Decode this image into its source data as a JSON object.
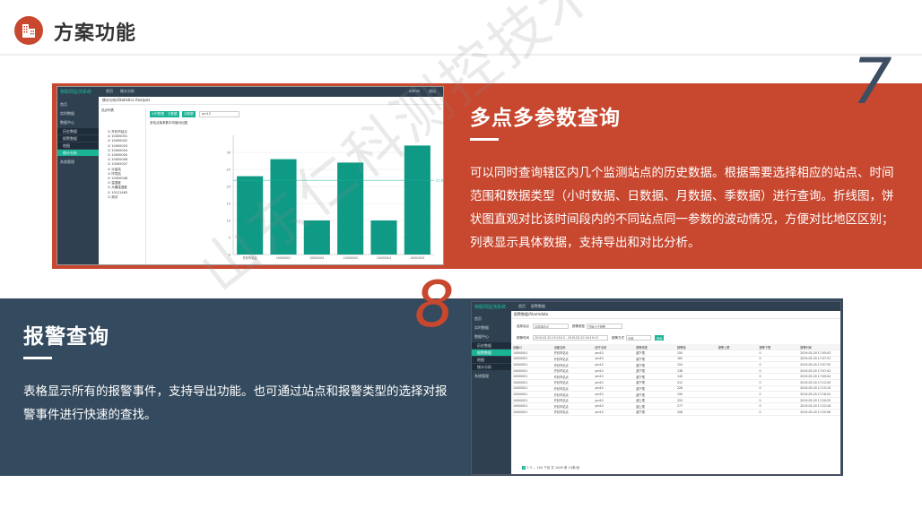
{
  "header": {
    "title": "方案功能"
  },
  "section7": {
    "number": "7",
    "title": "多点多参数查询",
    "description": "可以同时查询辖区内几个监测站点的历史数据。根据需要选择相应的站点、时间范围和数据类型（小时数据、日数据、月数据、季数据）进行查询。折线图，饼状图直观对比该时间段内的不同站点同一参数的波动情况，方便对比地区区别；列表显示具体数据，支持导出和对比分析。"
  },
  "section8": {
    "number": "8",
    "title": "报警查询",
    "description": "表格显示所有的报警事件，支持导出功能。也可通过站点和报警类型的选择对报警事件进行快速的查找。"
  },
  "watermark": "山东仁科测控技术有限公司",
  "screenshot1": {
    "brand": "物联网监测系统",
    "nav": [
      "首页",
      "统计分析"
    ],
    "user": [
      "admin",
      "退出"
    ],
    "sidebar": [
      "首页",
      "实时数据",
      "数据中心",
      "历史数据",
      "报警数据",
      "地图",
      "统计分析",
      "系统管理"
    ],
    "breadcrumb": "统计分析/Statistics Analysis",
    "tree_title": "站点列表",
    "tree_items": [
      "站点列表",
      "开封市站点",
      "10000001",
      "10000002",
      "10000003",
      "10000004",
      "10000005",
      "10000006",
      "10000007",
      "计量站",
      "环境站",
      "10000008",
      "温湿度",
      "大棚温湿度",
      "10121465",
      "测试"
    ],
    "tabs": [
      "小时数据",
      "日数据",
      "月数据"
    ],
    "select": "pm10",
    "chart_title": "多站点各参数平均值对比图",
    "colors": {
      "accent": "#1ab394",
      "bar": "#0f9a86",
      "sidebar": "#2f4050"
    }
  },
  "screenshot2": {
    "brand": "物联网监测系统",
    "nav": [
      "首页",
      "报警数据"
    ],
    "breadcrumb": "报警数据/Alarmdata",
    "filters": {
      "station_label": "选择站点",
      "station_value": "请选择站点",
      "type_label": "报警类型",
      "type_value": "开始小于报警",
      "time_label": "报警时间",
      "time_value": "2019-05-20 15:19:13 - 2019-05-20 16:19:13",
      "export_label": "报警方式",
      "export_value": "全部",
      "query_button": "查询"
    },
    "table": {
      "headers": [
        "设备ID",
        "设备名称",
        "因子名称",
        "报警类型",
        "报警值",
        "报警上限",
        "报警下限",
        "报警时间"
      ],
      "rows": [
        [
          "10000001",
          "开封市站点",
          "pm10",
          "超下限",
          "150",
          "",
          "0",
          "2019-05-20 17:05:03"
        ],
        [
          "10000001",
          "开封市站点",
          "pm10",
          "超下限",
          "162",
          "",
          "0",
          "2019-05-20 17:07:31"
        ],
        [
          "10000001",
          "开封市站点",
          "pm10",
          "超下限",
          "154",
          "",
          "0",
          "2019-05-20 17:07:35"
        ],
        [
          "10000001",
          "开封市站点",
          "pm10",
          "超下限",
          "138",
          "",
          "0",
          "2019-05-20 17:07:42"
        ],
        [
          "10000001",
          "开封市站点",
          "pm10",
          "超下限",
          "140",
          "",
          "0",
          "2019-05-20 17:09:04"
        ],
        [
          "10000001",
          "开封市站点",
          "pm10",
          "超下限",
          "212",
          "",
          "0",
          "2019-05-20 17:12:45"
        ],
        [
          "10000001",
          "开封市站点",
          "pm10",
          "超下限",
          "226",
          "",
          "0",
          "2019-05-20 17:15:10"
        ],
        [
          "10000001",
          "开封市站点",
          "pm10",
          "超下限",
          "190",
          "",
          "0",
          "2019-05-20 17:18:20"
        ],
        [
          "10000001",
          "开封市站点",
          "pm10",
          "超上限",
          "255",
          "",
          "0",
          "2019-05-20 17:20:33"
        ],
        [
          "10000001",
          "开封市站点",
          "pm10",
          "超上限",
          "277",
          "",
          "0",
          "2019-05-20 17:22:18"
        ],
        [
          "10000001",
          "开封市站点",
          "pm10",
          "超下限",
          "208",
          "",
          "0",
          "2019-05-20 17:25:06"
        ]
      ]
    },
    "pager": "1 2 3 ... 100 下页 共 1000 条 10条/页"
  },
  "chart_data": {
    "type": "bar",
    "title": "",
    "categories": [
      "开封市站点",
      "10000001",
      "10000002",
      "10000003",
      "10000004",
      "10000005"
    ],
    "values": [
      23,
      28,
      10,
      27,
      10,
      32
    ],
    "ylim": [
      0,
      35
    ],
    "yticks": [
      0,
      5,
      10,
      15,
      20,
      25,
      30
    ],
    "reference_line": 21.8,
    "reference_label": "21.8"
  }
}
